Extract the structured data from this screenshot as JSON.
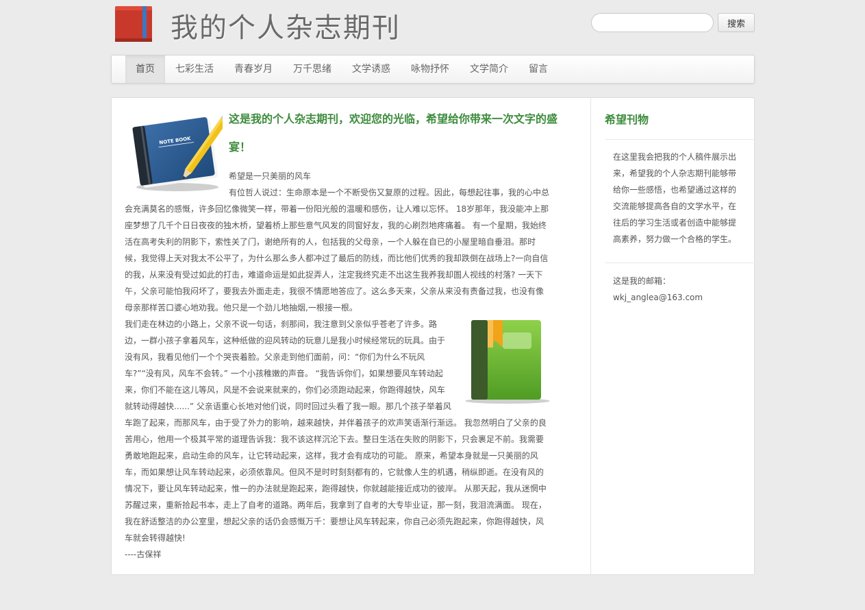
{
  "header": {
    "site_title": "我的个人杂志期刊",
    "search_placeholder": "",
    "search_button": "搜索"
  },
  "nav": {
    "items": [
      {
        "label": "首页",
        "active": true
      },
      {
        "label": "七彩生活"
      },
      {
        "label": "青春岁月"
      },
      {
        "label": "万千思绪"
      },
      {
        "label": "文学诱惑"
      },
      {
        "label": "咏物抒怀"
      },
      {
        "label": "文学简介"
      },
      {
        "label": "留言"
      }
    ]
  },
  "article": {
    "heading": "这是我的个人杂志期刊，欢迎您的光临，希望给你带来一次文字的盛宴！",
    "intro_line": "希望是一只美丽的风车",
    "para1": "有位哲人说过：生命原本是一个不断受伤又复原的过程。因此，每想起往事，我的心中总会充满莫名的感慨，许多回忆像微笑一样，带着一份阳光般的温暖和感伤，让人难以忘怀。 18岁那年，我没能冲上那座梦想了几千个日日夜夜的独木桥，望着桥上那些意气风发的同窗好友，我的心刷烈地疼痛着。 有一个星期，我始终活在高考失利的阴影下，索性关了门，谢绝所有的人，包括我的父母亲，一个人躲在自已的小屋里暗自垂泪。那时候，我觉得上天对我太不公平了，为什么那么多人都冲过了最后的防线，而比他们优秀的我却跌倒在战场上?一向自信的我，从来没有受过如此的打击，难道命运是如此捉弄人，注定我终究走不出这生我养我却圄人视线的村落? 一天下午，父亲可能怕我闷坏了，要我去外面走走，我很不情愿地答应了。这么多天来，父亲从来没有责备过我，也没有像母亲那样苦口婆心地劝我。他只是一个劲儿地抽烟,一根接一根。",
    "para2": "我们走在林边的小路上，父亲不说一句话，刹那间，我注意到父亲似乎苍老了许多。路边，一群小孩子拿着风车，这种纸做的迎风转动的玩意儿是我小时候经常玩的玩具。由于没有风，我看见他们一个个哭丧着脸。父亲走到他们面前，问：“你们为什么不玩风车?”“没有风，风车不会转。” 一个小孩稚嫩的声音。 “我告诉你们，如果想要风车转动起来，你们不能在这儿等风，风是不会说来就来的，你们必须跑动起来，你跑得越快，风车就转动得越快......” 父亲语重心长地对他们说，同时回过头看了我一眼。那几个孩子举着风车跑了起来，而那风车，由于受了外力的影响，越来越快，并伴着孩子的欢声笑语渐行渐远。 我忽然明白了父亲的良苦用心，他用一个极其平常的道理告诉我：我不该这样沉沦下去。整日生活在失败的阴影下，只会裹足不前。我需要勇敢地跑起来，启动生命的风车，让它转动起来，这样，我才会有成功的可能。 原来，希望本身就是一只美丽的风车，而如果想让风车转动起来，必须依靠风。但风不是时时刻刻都有的，它就像人生的机遇，稍纵即逝。在没有风的情况下，要让风车转动起来，惟一的办法就是跑起来，跑得越快，你就越能接近成功的彼岸。 从那天起，我从迷惘中苏醒过来，重新拾起书本，走上了自考的道路。两年后，我拿到了自考的大专毕业证，那一刻，我泪流满面。 现在，我在舒适整洁的办公室里，想起父亲的话仍会感慨万千：要想让风车转起来，你自己必须先跑起来，你跑得越快，风车就会转得越快!",
    "signature": "----古保祥",
    "notebook_label": "NOTE BOOK"
  },
  "sidebar": {
    "title": "希望刊物",
    "description": "在这里我会把我的个人稿件展示出来，希望我的个人杂志期刊能够带给你一些感悟，也希望通过这样的交流能够提高各自的文学水平，在往后的学习生活或者创造中能够提高素养，努力做一个合格的学生。",
    "email_label": "这是我的邮箱：",
    "email": "wkj_anglea@163.com"
  },
  "colors": {
    "accent_green": "#3d8c3d",
    "book_red": "#c8392b",
    "book_blue": "#2f5e93",
    "book_green": "#66b92e"
  }
}
